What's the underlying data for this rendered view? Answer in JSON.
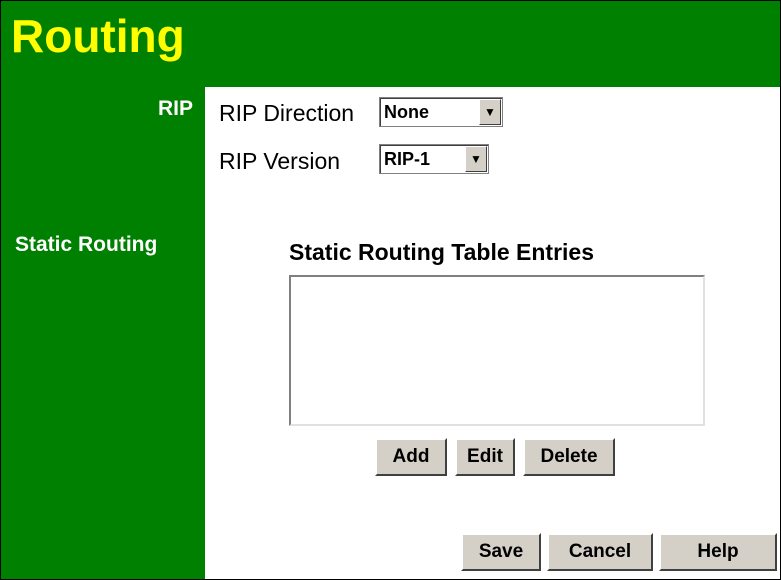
{
  "page": {
    "title": "Routing"
  },
  "sidebar": {
    "rip_label": "RIP",
    "static_label": "Static Routing"
  },
  "rip": {
    "direction_label": "RIP Direction",
    "direction_value": "None",
    "version_label": "RIP Version",
    "version_value": "RIP-1"
  },
  "static_routing": {
    "table_title": "Static Routing Table Entries",
    "entries": [],
    "add_label": "Add",
    "edit_label": "Edit",
    "delete_label": "Delete"
  },
  "footer": {
    "save_label": "Save",
    "cancel_label": "Cancel",
    "help_label": "Help"
  },
  "colors": {
    "header_bg": "#008000",
    "title": "#ffff00",
    "sidebar_text": "#ffffff",
    "button_face": "#d4d0c8"
  },
  "icons": {
    "dropdown": "chevron-down-icon"
  }
}
